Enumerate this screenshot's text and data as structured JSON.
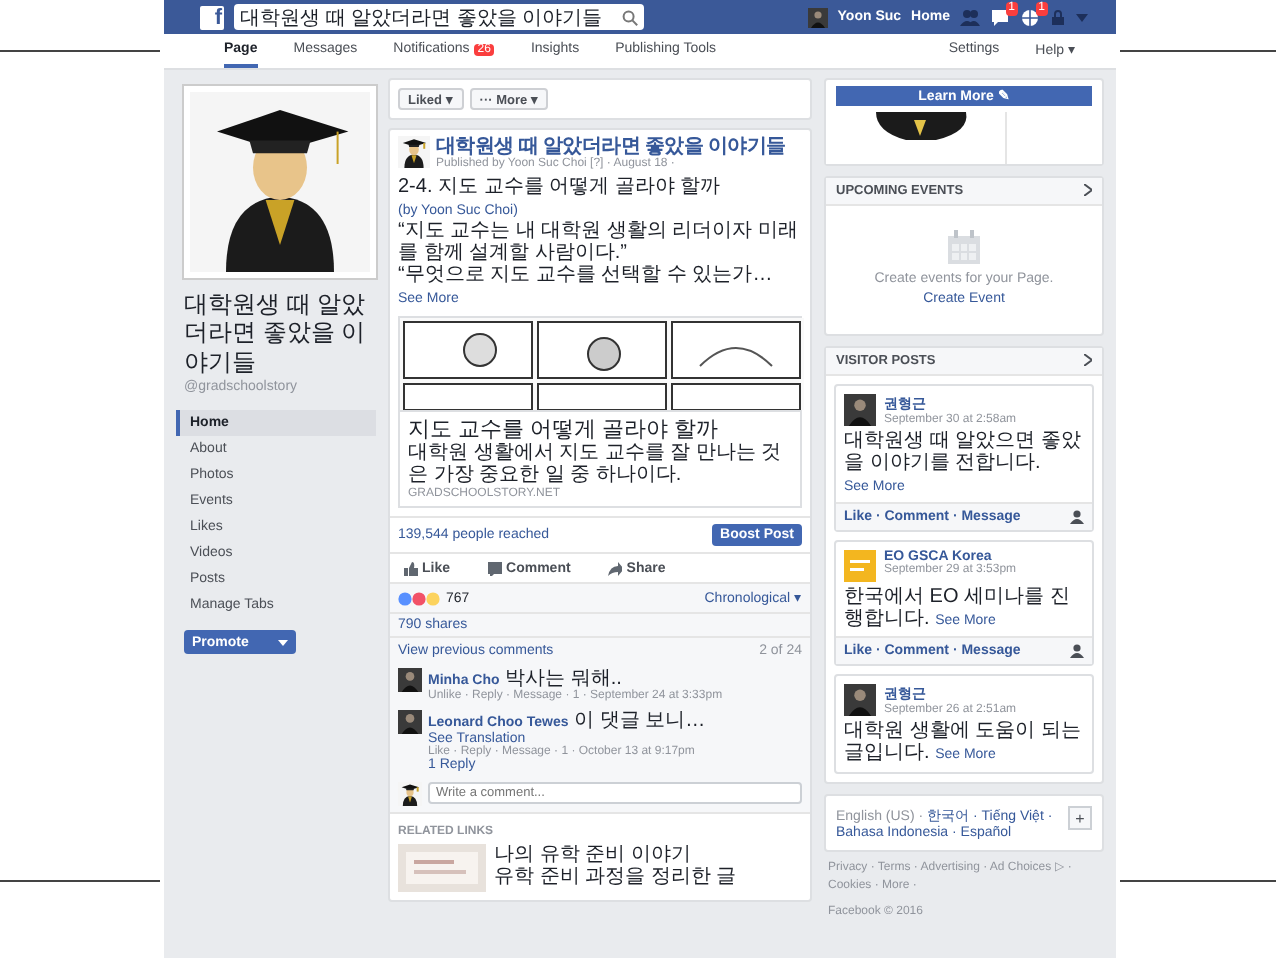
{
  "top_bar": {
    "logo": "f",
    "search": {
      "value": "대학원생 때 알았더라면 좋았을 이야기들"
    },
    "user": "Yoon Suc",
    "home": "Home",
    "icons": [
      {
        "kind": "friends"
      },
      {
        "kind": "messages",
        "badge": "1"
      },
      {
        "kind": "globe",
        "badge": "1"
      }
    ]
  },
  "tabs": [
    {
      "label": "Page",
      "selected": true
    },
    {
      "label": "Messages",
      "selected": false
    },
    {
      "label": "Notifications",
      "badge": "26",
      "selected": false
    },
    {
      "label": "Insights",
      "selected": false
    },
    {
      "label": "Publishing Tools",
      "selected": false
    }
  ],
  "tabs_right": [
    "Settings",
    "Help ▾"
  ],
  "sidebar": {
    "page_name": "대학원생 때 알았더라면 좋았을 이야기들",
    "handle": "@gradschoolstory",
    "items": [
      {
        "label": "Home",
        "selected": true
      },
      {
        "label": "About",
        "selected": false
      },
      {
        "label": "Photos",
        "selected": false
      },
      {
        "label": "Events",
        "selected": false
      },
      {
        "label": "Likes",
        "selected": false
      },
      {
        "label": "Videos",
        "selected": false
      },
      {
        "label": "Posts",
        "selected": false
      },
      {
        "label": "Manage Tabs",
        "selected": false
      }
    ],
    "promote": "Promote"
  },
  "page_actions": [
    "Liked ▾",
    "··· More ▾"
  ],
  "post": {
    "page": "대학원생 때 알았더라면 좋았을 이야기들",
    "byline": "Published by Yoon Suc Choi [?] · August 18 ·",
    "title": "2-4. 지도 교수를 어떻게 골라야 할까",
    "title_link": "(by Yoon Suc Choi)",
    "paragraphs": [
      "“지도 교수는 내 대학원 생활의 리더이자 미래를 함께 설계할 사람이다.”",
      "“무엇으로 지도 교수를 선택할 수 있는가…"
    ],
    "see_more": "See More",
    "link_card": {
      "title": "지도 교수를 어떻게 골라야 할까",
      "description": "대학원 생활에서 지도 교수를 잘 만나는 것은 가장 중요한 일 중 하나이다.",
      "domain": "GRADSCHOOLSTORY.NET"
    },
    "reach": "139,544 people reached",
    "boost": "Boost Post",
    "actions": [
      "Like",
      "Comment",
      "Share"
    ],
    "reactions": "767",
    "order": "Chronological ▾",
    "shares": "790 shares",
    "previous": "View previous comments",
    "count": "2 of 24",
    "comments": [
      {
        "author": "Minha Cho",
        "text": "박사는 뭐해..",
        "meta": "Unlike · Reply · Message · 1 · September 24 at 3:33pm"
      },
      {
        "author": "Leonard Choo Tewes",
        "text": "이 댓글 보니…",
        "translate": "See Translation",
        "meta": "Like · Reply · Message · 1 · October 13 at 9:17pm",
        "reply": "1 Reply"
      }
    ],
    "write_placeholder": "Write a comment...",
    "related_header": "RELATED LINKS",
    "related": [
      {
        "title": "나의 유학 준비 이야기",
        "text": "유학 준비 과정을 정리한 글"
      }
    ]
  },
  "right": {
    "learn_more": "Learn More ✎",
    "events": {
      "header": "UPCOMING EVENTS",
      "text": "Create events for your Page.",
      "link": "Create Event"
    },
    "visitor_header": "VISITOR POSTS",
    "visitor_posts": [
      {
        "author": "권형근",
        "time": "September 30 at 2:58am",
        "text": "대학원생 때 알았으면 좋았을 이야기를 전합니다.",
        "see_more": "See More",
        "actions": "Like · Comment · Message",
        "kind": "person"
      },
      {
        "author": "EO GSCA Korea",
        "time": "September 29 at 3:53pm",
        "text": "한국에서 EO 세미나를 진행합니다.",
        "see_more": "See More",
        "actions": "Like · Comment · Message",
        "kind": "logo"
      },
      {
        "author": "권형근",
        "time": "September 26 at 2:51am",
        "text": "대학원 생활에 도움이 되는 글입니다.",
        "see_more": "See More",
        "kind": "person"
      }
    ],
    "languages": [
      "English (US) ·",
      "한국어 ·",
      "Tiếng Việt ·",
      "Bahasa Indonesia ·",
      "Español"
    ],
    "add": "+",
    "footer": "Privacy · Terms · Advertising · Ad Choices ▷ · Cookies · More ·",
    "copyright": "Facebook © 2016"
  }
}
